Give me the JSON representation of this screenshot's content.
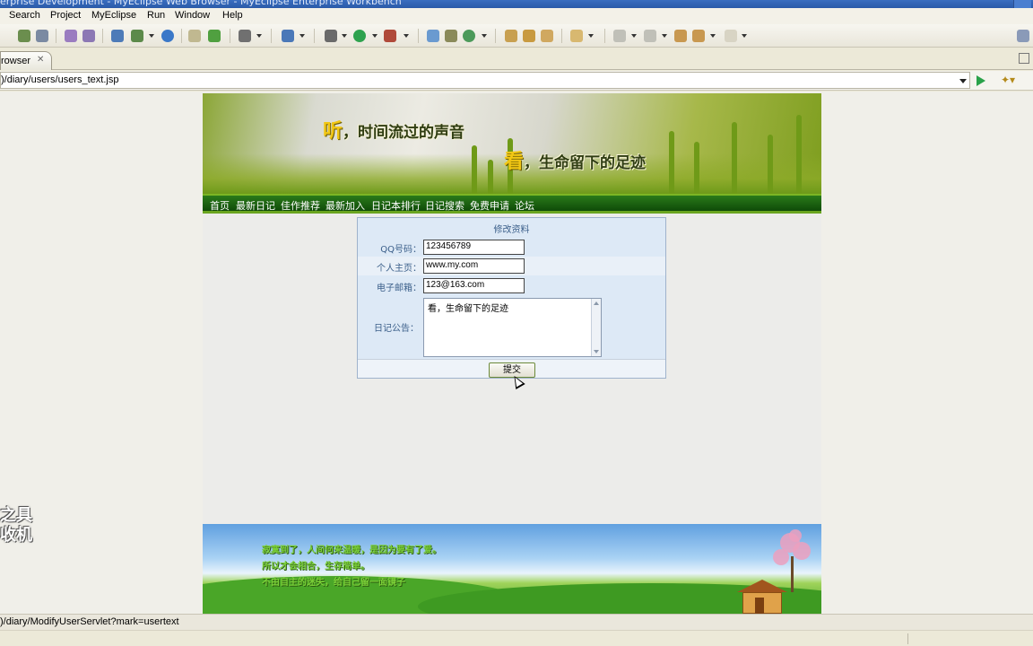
{
  "window": {
    "title": "erprise Development - MyEclipse Web Browser - MyEclipse Enterprise Workbench"
  },
  "menu": [
    {
      "label": "Search"
    },
    {
      "label": "Project"
    },
    {
      "label": "MyEclipse"
    },
    {
      "label": "Run"
    },
    {
      "label": "Window"
    },
    {
      "label": "Help"
    }
  ],
  "tab": {
    "label": "rowser",
    "close": "✕"
  },
  "address": {
    "url": ")/diary/users/users_text.jsp"
  },
  "site": {
    "slogan_1": "，时间流过的声音",
    "slogan_1_big": "听",
    "slogan_2": "，生命留下的足迹",
    "slogan_2_big": "看",
    "nav": [
      {
        "label": "首页"
      },
      {
        "label": "最新日记"
      },
      {
        "label": "佳作推荐"
      },
      {
        "label": "最新加入"
      },
      {
        "label": "日记本排行"
      },
      {
        "label": "日记搜索"
      },
      {
        "label": "免费申请"
      },
      {
        "label": "论坛"
      }
    ]
  },
  "form": {
    "title": "修改资料",
    "qq_label": "QQ号码：",
    "qq_value": "123456789",
    "homepage_label": "个人主页：",
    "homepage_value": "www.my.com",
    "email_label": "电子邮箱：",
    "email_value": "123@163.com",
    "notice_label": "日记公告：",
    "notice_value": "看，生命留下的足迹",
    "submit_label": "提交"
  },
  "footer": {
    "line_1": "寂寞到了，人间何来温暖，是因为要有了爱。",
    "line_2": "所以才会相合，生存简单。",
    "line_3": "不由自主的迷失，给自己留一面镜子"
  },
  "watermark": {
    "line_1": "之具",
    "line_2": "收机"
  },
  "status": {
    "text": ")/diary/ModifyUserServlet?mark=usertext"
  }
}
